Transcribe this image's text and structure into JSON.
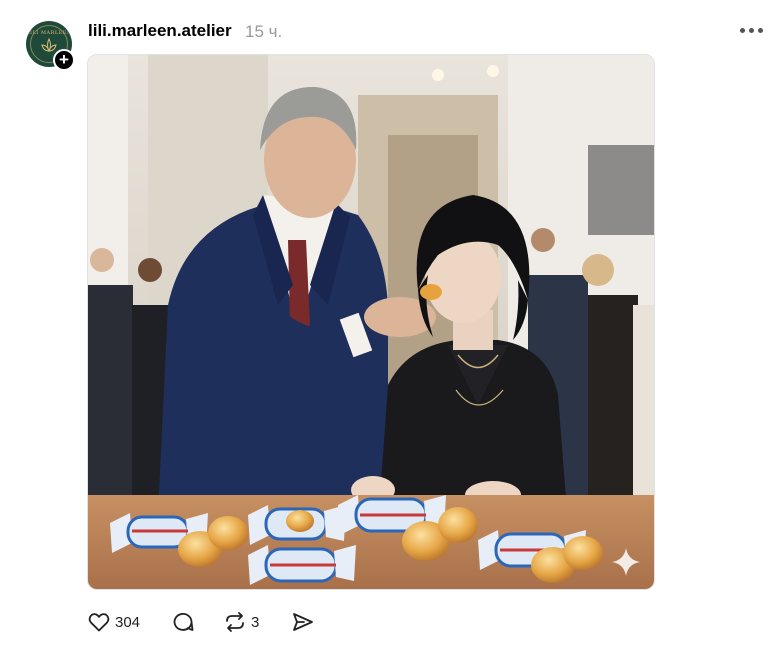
{
  "post": {
    "username": "lili.marleen.atelier",
    "time": "15 ч.",
    "avatar_text": "LILI MARLEEN",
    "actions": {
      "likes": "304",
      "reposts": "3"
    }
  },
  "colors": {
    "accent_dark": "#1f4a3a",
    "meta_gray": "#999999"
  },
  "icons": [
    "heart-icon",
    "comment-icon",
    "repost-icon",
    "share-icon",
    "more-icon",
    "plus-icon",
    "sparkle-icon"
  ]
}
